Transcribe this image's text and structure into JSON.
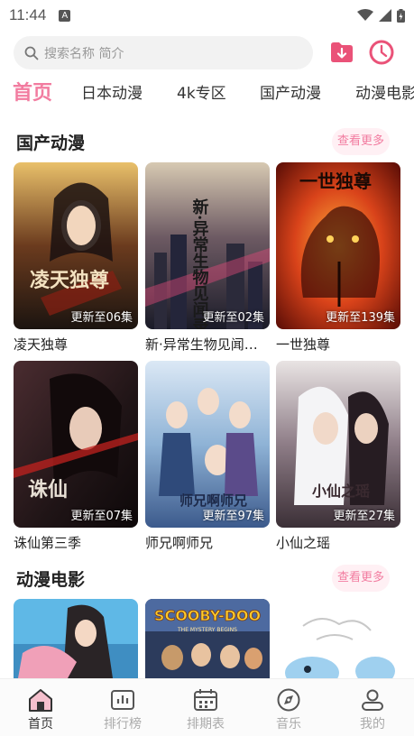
{
  "status": {
    "time": "11:44",
    "notice_letter": "A"
  },
  "search": {
    "placeholder": "搜索名称 简介"
  },
  "tabs": [
    {
      "label": "首页",
      "active": true
    },
    {
      "label": "日本动漫",
      "active": false
    },
    {
      "label": "4k专区",
      "active": false
    },
    {
      "label": "国产动漫",
      "active": false
    },
    {
      "label": "动漫电影",
      "active": false
    }
  ],
  "sections": [
    {
      "title": "国产动漫",
      "more_label": "查看更多",
      "cards": [
        {
          "title": "凌天独尊",
          "episode": "更新至06集",
          "poster_icon": "fantasy-warrior-poster",
          "poster_text": "凌天独尊",
          "poster_color": "#3a2a1f"
        },
        {
          "title": "新·异常生物见闻…",
          "episode": "更新至02集",
          "poster_icon": "city-night-poster",
          "poster_text": "新·异常生物见闻录",
          "poster_color": "#1c2030"
        },
        {
          "title": "一世独尊",
          "episode": "更新至139集",
          "poster_icon": "tiger-fire-poster",
          "poster_text": "一世独尊",
          "poster_color": "#b12a10"
        },
        {
          "title": "诛仙第三季",
          "episode": "更新至07集",
          "poster_icon": "dark-swordsman-poster",
          "poster_text": "诛仙",
          "poster_color": "#2a1a1c"
        },
        {
          "title": "师兄啊师兄",
          "episode": "更新至97集",
          "poster_icon": "group-heroes-poster",
          "poster_text": "师兄啊师兄",
          "poster_color": "#7aa0c8"
        },
        {
          "title": "小仙之瑶",
          "episode": "更新至27集",
          "poster_icon": "white-hair-poster",
          "poster_text": "小仙之瑶",
          "poster_color": "#6a5a66"
        }
      ]
    },
    {
      "title": "动漫电影",
      "more_label": "查看更多",
      "cards": [
        {
          "poster_icon": "anime-girl-poster",
          "poster_color": "#4fb0e0"
        },
        {
          "poster_icon": "scooby-doo-poster",
          "poster_text": "SCOOBY-DOO",
          "poster_subtext": "THE MYSTERY BEGINS",
          "poster_color": "#2b3a5a"
        },
        {
          "poster_icon": "cartoon-creature-poster",
          "poster_color": "#ffffff"
        }
      ]
    }
  ],
  "bottom_nav": [
    {
      "label": "首页",
      "icon": "home-icon",
      "active": true
    },
    {
      "label": "排行榜",
      "icon": "ranking-icon",
      "active": false
    },
    {
      "label": "排期表",
      "icon": "calendar-icon",
      "active": false
    },
    {
      "label": "音乐",
      "icon": "compass-icon",
      "active": false
    },
    {
      "label": "我的",
      "icon": "profile-icon",
      "active": false
    }
  ],
  "colors": {
    "accent": "#f27ca0",
    "accent_dark": "#ea5278",
    "more_bg": "#fff0f4"
  }
}
